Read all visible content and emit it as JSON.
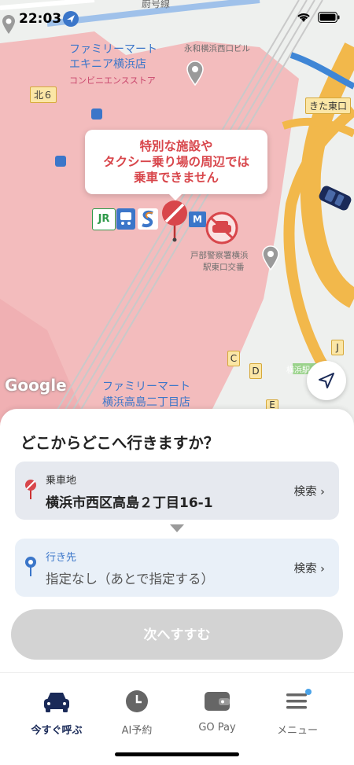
{
  "status": {
    "time": "22:03"
  },
  "map": {
    "labels": {
      "top_road": "嶎号線",
      "familymart1_line1": "ファミリーマート",
      "familymart1_line2": "エキニア横浜店",
      "convenience": "コンビニエンスストア",
      "eiwa": "永和横浜西口ビル",
      "kita6": "北６",
      "kita_higashi": "きた東口",
      "police_line1": "戸部警察署横浜",
      "police_line2": "駅東口交番",
      "box_c": "C",
      "box_d": "D",
      "box_j": "J",
      "box_e": "E",
      "yokohama_small": "横浜駅",
      "familymart2_line1": "ファミリーマート",
      "familymart2_line2": "横浜高島二丁目店",
      "google": "Google",
      "jr": "JR"
    },
    "notice_lines": [
      "特別な施設や",
      "タクシー乗り場の周辺では",
      "乗車できません"
    ]
  },
  "sheet": {
    "question": "どこからどこへ行きますか？",
    "pickup": {
      "label": "乗車地",
      "value": "横浜市西区高島２丁目16-1",
      "search": "検索 ›"
    },
    "destination": {
      "label": "行き先",
      "placeholder": "指定なし（あとで指定する）",
      "search": "検索 ›"
    },
    "next_button": "次へすすむ"
  },
  "tabs": [
    {
      "label": "今すぐ呼ぶ",
      "icon": "taxi-icon",
      "active": true
    },
    {
      "label": "AI予約",
      "icon": "clock-icon",
      "active": false
    },
    {
      "label": "GO Pay",
      "icon": "wallet-icon",
      "active": false
    },
    {
      "label": "メニュー",
      "icon": "menu-icon",
      "active": false
    }
  ],
  "colors": {
    "accent": "#1a2a58",
    "restricted_text": "#d8464b",
    "restricted_area": "#f3b3b4",
    "button_disabled": "#d3d3d3"
  }
}
